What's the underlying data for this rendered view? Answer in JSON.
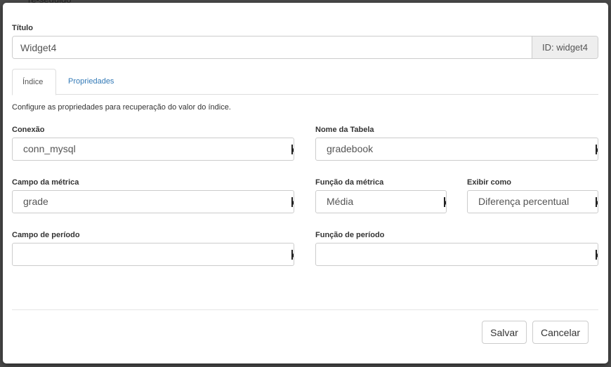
{
  "backdrop": {
    "peek_text": "re-seguido"
  },
  "modal": {
    "title_label": "Título",
    "title_value": "Widget4",
    "id_addon": "ID: widget4",
    "tabs": [
      {
        "label": "Índice",
        "active": true
      },
      {
        "label": "Propriedades",
        "active": false
      }
    ],
    "help_text": "Configure as propriedades para recuperação do valor do índice.",
    "fields": {
      "conexao": {
        "label": "Conexão",
        "value": "conn_mysql"
      },
      "tabela": {
        "label": "Nome da Tabela",
        "value": "gradebook"
      },
      "campo_metrica": {
        "label": "Campo da métrica",
        "value": "grade"
      },
      "funcao_metrica": {
        "label": "Função da métrica",
        "value": "Média"
      },
      "exibir_como": {
        "label": "Exibir como",
        "value": "Diferença percentual"
      },
      "campo_periodo": {
        "label": "Campo de período",
        "value": ""
      },
      "funcao_periodo": {
        "label": "Função de período",
        "value": ""
      }
    },
    "buttons": {
      "save": "Salvar",
      "cancel": "Cancelar"
    }
  },
  "colors": {
    "link": "#337ab7",
    "addon_bg": "#eeeeee",
    "border": "#cccccc"
  }
}
